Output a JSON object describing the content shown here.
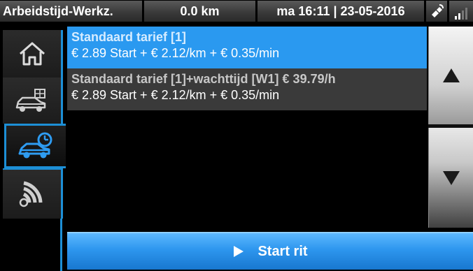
{
  "status": {
    "mode": "Arbeidstijd-Werkz.",
    "distance": "0.0 km",
    "datetime": "ma 16:11 | 23-05-2016",
    "network_icon": "satellite-icon",
    "signal_icon": "signal-bars-icon"
  },
  "sidebar": {
    "items": [
      {
        "icon": "home-icon"
      },
      {
        "icon": "taxi-meter-icon"
      },
      {
        "icon": "car-tariff-icon",
        "selected": true
      },
      {
        "icon": "wireless-signal-icon"
      }
    ]
  },
  "tariffs": [
    {
      "name": "Standaard tarief [1]",
      "price": "€ 2.89 Start + € 2.12/km + € 0.35/min",
      "selected": true
    },
    {
      "name": "Standaard tarief [1]+wachttijd [W1] € 39.79/h",
      "price": "€ 2.89 Start + € 2.12/km + € 0.35/min",
      "selected": false
    }
  ],
  "scroll": {
    "up_icon": "triangle-up-icon",
    "down_icon": "triangle-down-icon"
  },
  "start_button": {
    "label": "Start rit",
    "icon": "play-icon"
  },
  "colors": {
    "accent": "#2a99f0",
    "border": "#1d8fd6",
    "row_alt": "#3a3a3a"
  }
}
